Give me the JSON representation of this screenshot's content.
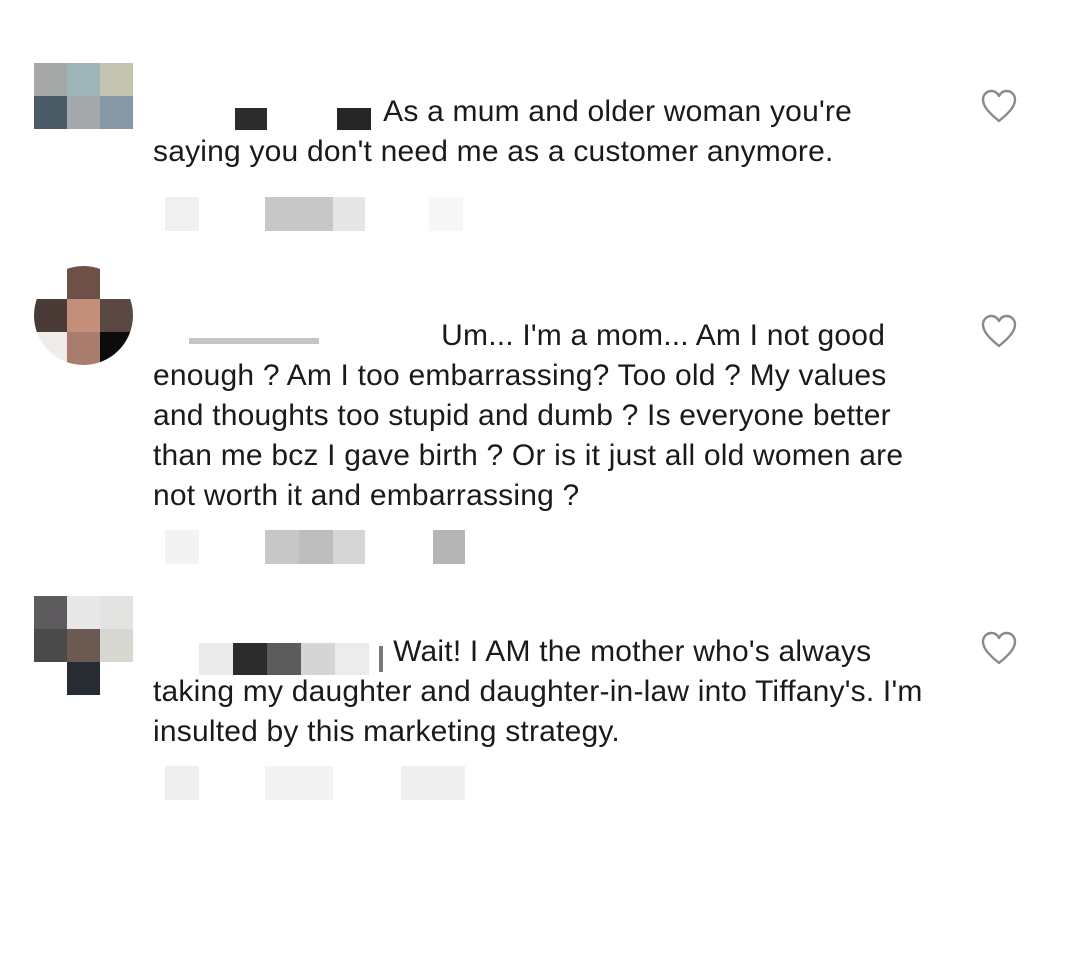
{
  "comments": [
    {
      "text": "As a mum and older woman you're saying you don't need me as a customer anymore.",
      "avatar_colors": [
        "#a5a8a7",
        "#9fb5b7",
        "#c5c4b0",
        "#4a5b66",
        "#a4a8ab",
        "#8797a5",
        "#ffffff",
        "#ffffff",
        "#ffffff"
      ],
      "username_blocks": [
        "#ffffff",
        "#2c2c2c",
        "#ffffff",
        "#262626"
      ],
      "meta_blocks": [
        "#f0f0f0",
        "#c8c8c8",
        "#e6e6e6",
        "#f7f7f7"
      ]
    },
    {
      "text": "Um... I'm a mom... Am I not good enough ? Am I too embarrassing? Too old ? My values and thoughts too stupid and dumb ? Is everyone better than me bcz I gave birth ? Or is it just all old women are not worth it and embarrassing ?",
      "avatar_colors": [
        "#ffffff",
        "#6d5146",
        "#ffffff",
        "#4a3b36",
        "#c48f7a",
        "#5a4842",
        "#f1ecea",
        "#a97c6d",
        "#0e0b0b"
      ],
      "username_blocks": [
        "#c5c5c5",
        "#ffffff"
      ],
      "meta_blocks": [
        "#f3f3f3",
        "#c7c7c7",
        "#bdbdbd",
        "#d6d6d6",
        "#b5b5b5"
      ]
    },
    {
      "text": "Wait! I AM the mother who's always taking my daughter and daughter-in-law into Tiffany's. I'm insulted by this marketing strategy.",
      "avatar_colors": [
        "#5d5b5d",
        "#e8e8e8",
        "#e3e3e1",
        "#4a4a4a",
        "#6b5a52",
        "#d8d8d2",
        "#ffffff",
        "#262c31",
        "#ffffff"
      ],
      "username_blocks": [
        "#ebebeb",
        "#2b2b2b",
        "#5c5c5c",
        "#d5d5d5",
        "#ececec",
        "#7a7a7a"
      ],
      "meta_blocks": [
        "#eeeeee",
        "#f3f3f3",
        "#efefef"
      ]
    }
  ],
  "ui": {
    "like_icon": "heart-outline-icon",
    "heart_stroke_color": "#8a8a8a"
  }
}
